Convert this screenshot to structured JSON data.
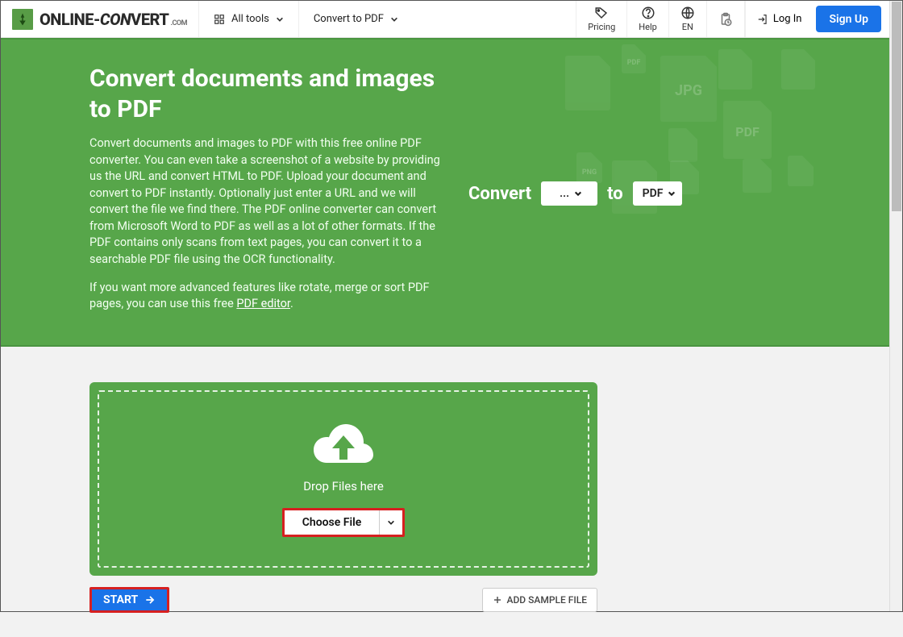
{
  "header": {
    "brand_prefix": "ONLINE-",
    "brand_on": "CON",
    "brand_suffix": "VERT",
    "brand_tld": ".COM",
    "all_tools": "All tools",
    "convert_to_pdf": "Convert to PDF",
    "pricing": "Pricing",
    "help": "Help",
    "lang": "EN",
    "login": "Log In",
    "signup": "Sign Up"
  },
  "hero": {
    "title": "Convert documents and images to PDF",
    "p1": "Convert documents and images to PDF with this free online PDF converter. You can even take a screenshot of a website by providing us the URL and convert HTML to PDF. Upload your document and convert to PDF instantly. Optionally just enter a URL and we will convert the file we find there. The PDF online converter can convert from Microsoft Word to PDF as well as a lot of other formats. If the PDF contains only scans from text pages, you can convert it to a searchable PDF file using the OCR functionality.",
    "p2_prefix": "If you want more advanced features like rotate, merge or sort PDF pages, you can use this free ",
    "p2_link": "PDF editor",
    "p2_suffix": ".",
    "convert_label": "Convert",
    "from_value": "...",
    "to_label": "to",
    "to_value": "PDF"
  },
  "dropzone": {
    "drop_label": "Drop Files here",
    "choose_label": "Choose File"
  },
  "actions": {
    "start": "START",
    "add_sample": "ADD SAMPLE FILE"
  }
}
